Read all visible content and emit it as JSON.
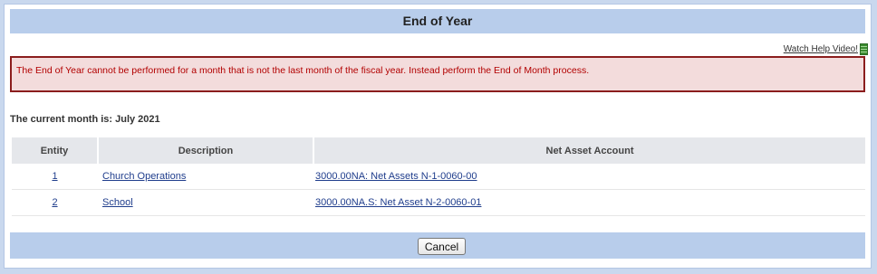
{
  "page": {
    "title": "End of Year"
  },
  "help": {
    "label": "Watch Help Video!",
    "icon": "film-icon"
  },
  "error": {
    "message": "The End of Year cannot be performed for a month that is not the last month of the fiscal year. Instead perform the End of Month process."
  },
  "current_month_text": "The current month is: July 2021",
  "table": {
    "headers": {
      "entity": "Entity",
      "description": "Description",
      "account": "Net Asset Account"
    },
    "rows": [
      {
        "entity": "1",
        "description": "Church Operations",
        "account": "3000.00NA: Net Assets N-1-0060-00"
      },
      {
        "entity": "2",
        "description": "School",
        "account": "3000.00NA.S: Net Asset N-2-0060-01"
      }
    ]
  },
  "footer": {
    "cancel_label": "Cancel"
  },
  "colors": {
    "header_bar": "#b8cdeb",
    "error_border": "#8b1d1d",
    "error_text": "#b20000",
    "link": "#1f3d8c"
  }
}
